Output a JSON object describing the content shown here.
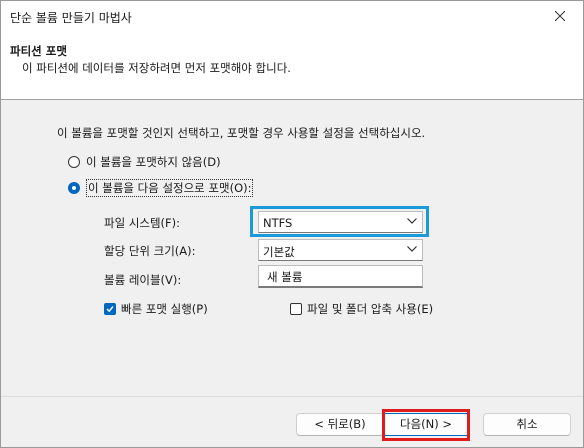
{
  "window": {
    "title": "단순 볼륨 만들기 마법사"
  },
  "header": {
    "title": "파티션 포맷",
    "subtitle": "이 파티션에 데이터를 저장하려면 먼저 포맷해야 합니다."
  },
  "instruction": "이 볼륨을 포맷할 것인지 선택하고, 포맷할 경우 사용할 설정을 선택하십시오.",
  "options": {
    "no_format": {
      "label": "이 볼륨을 포맷하지 않음(D)",
      "checked": false
    },
    "format": {
      "label": "이 볼륨을 다음 설정으로 포맷(O):",
      "checked": true
    }
  },
  "settings": {
    "file_system": {
      "label": "파일 시스템(F):",
      "value": "NTFS"
    },
    "allocation_unit": {
      "label": "할당 단위 크기(A):",
      "value": "기본값"
    },
    "volume_label": {
      "label": "볼륨 레이블(V):",
      "value": "새 볼륨"
    },
    "quick_format": {
      "label": "빠른 포맷 실행(P)",
      "checked": true
    },
    "compression": {
      "label": "파일 및 폴더 압축 사용(E)",
      "checked": false
    }
  },
  "buttons": {
    "back": "< 뒤로(B)",
    "next": "다음(N) >",
    "cancel": "취소"
  },
  "colors": {
    "accent": "#0067c0",
    "highlight_blue": "#1a9ad8",
    "highlight_red": "#e01b1b"
  }
}
